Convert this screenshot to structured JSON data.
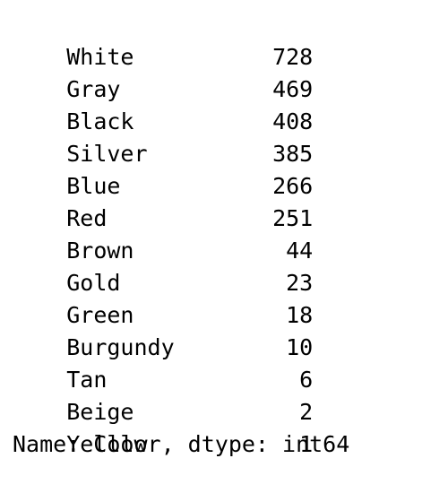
{
  "series": {
    "rows": [
      {
        "label": "White",
        "value": "728"
      },
      {
        "label": "Gray",
        "value": "469"
      },
      {
        "label": "Black",
        "value": "408"
      },
      {
        "label": "Silver",
        "value": "385"
      },
      {
        "label": "Blue",
        "value": "266"
      },
      {
        "label": "Red",
        "value": "251"
      },
      {
        "label": "Brown",
        "value": "44"
      },
      {
        "label": "Gold",
        "value": "23"
      },
      {
        "label": "Green",
        "value": "18"
      },
      {
        "label": "Burgundy",
        "value": "10"
      },
      {
        "label": "Tan",
        "value": "6"
      },
      {
        "label": "Beige",
        "value": "2"
      },
      {
        "label": "Yellow",
        "value": "1"
      }
    ],
    "footer": "Name: Color, dtype: int64"
  }
}
